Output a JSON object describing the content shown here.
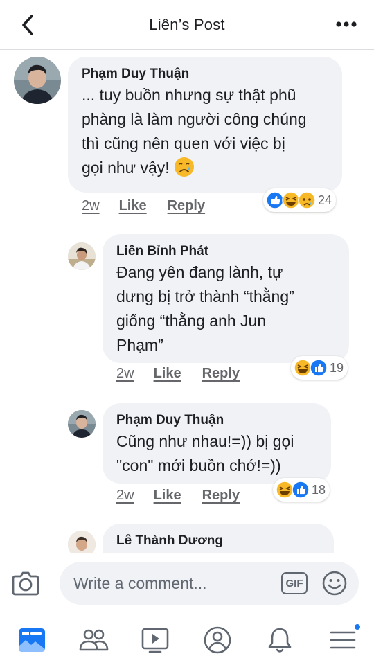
{
  "header": {
    "title": "Liên’s Post",
    "back_icon": "chevron-left-icon",
    "more_icon": "more-horizontal-icon"
  },
  "comments": [
    {
      "author": "Phạm Duy Thuận",
      "lines": [
        "... tuy buồn nhưng sự thật phũ",
        "phàng là làm người công chúng",
        "thì  cũng nên quen với việc bị",
        "gọi như vậy!"
      ],
      "inline_emoji": "disappointed-face-emoji",
      "time": "2w",
      "like_label": "Like",
      "reply_label": "Reply",
      "reaction_icons": [
        "like-reaction-icon",
        "haha-reaction-icon",
        "sad-reaction-icon"
      ],
      "reaction_count": "24"
    },
    {
      "author": "Liên Bỉnh Phát",
      "lines": [
        "Đang yên đang lành, tự",
        "dưng bị trở thành “thằng”",
        "giống “thằng anh Jun",
        "Phạm”"
      ],
      "time": "2w",
      "like_label": "Like",
      "reply_label": "Reply",
      "reaction_icons": [
        "haha-reaction-icon",
        "like-reaction-icon"
      ],
      "reaction_count": "19"
    },
    {
      "author": "Phạm Duy Thuận",
      "lines": [
        "Cũng như nhau!=)) bị gọi",
        "\"con\" mới buồn chớ!=))"
      ],
      "time": "2w",
      "like_label": "Like",
      "reply_label": "Reply",
      "reaction_icons": [
        "haha-reaction-icon",
        "like-reaction-icon"
      ],
      "reaction_count": "18"
    },
    {
      "author": "Lê Thành Dương",
      "lines": []
    }
  ],
  "composer": {
    "placeholder": "Write a comment...",
    "gif_label": "GIF",
    "camera_icon": "camera-icon",
    "sticker_icon": "smiley-icon"
  },
  "tabbar": {
    "items": [
      "news-feed-icon",
      "friends-icon",
      "watch-icon",
      "profile-icon",
      "notifications-icon",
      "menu-icon"
    ],
    "menu_has_badge": true
  },
  "colors": {
    "accent": "#1877f2",
    "bubble": "#f0f2f5",
    "secondary_text": "#65676b",
    "divider": "#dcdde0",
    "haha_yellow": "#f7b928"
  }
}
